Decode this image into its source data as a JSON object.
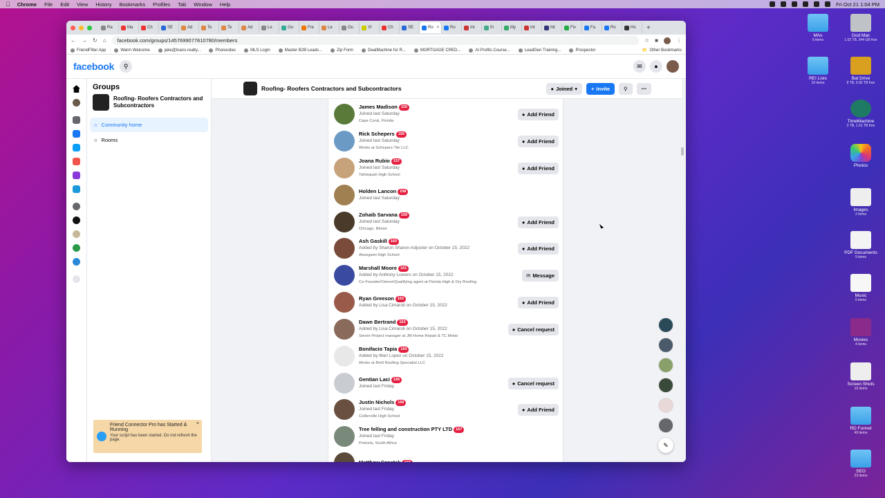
{
  "menubar": {
    "app": "Chrome",
    "items": [
      "File",
      "Edit",
      "View",
      "History",
      "Bookmarks",
      "Profiles",
      "Tab",
      "Window",
      "Help"
    ],
    "clock": "Fri Oct 21  1:04 PM"
  },
  "desktop": [
    {
      "label": "MAs",
      "sub": "6 items"
    },
    {
      "label": "God Mac",
      "sub": "1.02 TB, 344 GB free"
    },
    {
      "label": "REI Lists",
      "sub": "16 items"
    },
    {
      "label": "Bat Drive",
      "sub": "8 TB, 6.82 TB free"
    },
    {
      "label": "TimeMachine",
      "sub": "3 TB, 1.61 TB free"
    },
    {
      "label": "Photos",
      "sub": ""
    },
    {
      "label": "Images",
      "sub": "2 items"
    },
    {
      "label": "PDF Documents",
      "sub": "9 items"
    },
    {
      "label": "Music",
      "sub": "5 items"
    },
    {
      "label": "Movies",
      "sub": "4 items"
    },
    {
      "label": "Screen Shots",
      "sub": "16 items"
    },
    {
      "label": "RD Funnel",
      "sub": "49 items"
    },
    {
      "label": "SEO",
      "sub": "23 items"
    }
  ],
  "browser": {
    "tabs": [
      "Ra",
      "Ma",
      "Ch",
      "SE",
      "Ad",
      "Te",
      "Te",
      "Ad",
      "Le",
      "Go",
      "Fre",
      "Le",
      "Ou",
      "VI",
      "Ch",
      "SE",
      "Ro",
      "Ro",
      "Int",
      "fri",
      "My",
      "Int",
      "htt",
      "Fiv",
      "Fa",
      "Ro",
      "Ho"
    ],
    "url": "facebook.com/groups/1457699077810780/members",
    "bookmarks": [
      "FriendFilter App",
      "Warm Welcome",
      "jake@loans-realty...",
      "Phonesites",
      "MLS Login",
      "Master B2B Leads...",
      "Zip Form",
      "DealMachine for R...",
      "MORTGAGE CRED...",
      "AI Profits Course...",
      "LeadGen Training...",
      "Prospector"
    ],
    "other_bookmarks": "Other Bookmarks"
  },
  "fb": {
    "logo": "facebook",
    "sidebar": {
      "title": "Groups",
      "group_name": "Roofing- Roofers Contractors and Subcontractors",
      "nav": [
        {
          "label": "Community home"
        },
        {
          "label": "Rooms"
        }
      ]
    },
    "group_bar": {
      "title": "Roofing- Roofers Contractors and Subcontractors",
      "joined": "Joined",
      "invite": "Invite"
    },
    "toast": {
      "title": "Friend Connector Pro has Started & Running",
      "body": "Your script has been started. Do not refresh the page.",
      "close": "×"
    },
    "members": [
      {
        "name": "James Madison",
        "num": "155",
        "line1": "Joined last Saturday",
        "line2": "Cape Coral, Florida",
        "action": "Add Friend",
        "color": "#5a7a3a"
      },
      {
        "name": "Rick Schepers",
        "num": "156",
        "line1": "Joined last Saturday",
        "line2": "Works at Schepers Tile LLC",
        "action": "Add Friend",
        "color": "#6b9ac4"
      },
      {
        "name": "Joana Rubio",
        "num": "157",
        "line1": "Joined last Saturday",
        "line2": "Tahlequah High School",
        "action": "Add Friend",
        "color": "#c8a27a"
      },
      {
        "name": "Holden Lancon",
        "num": "158",
        "line1": "Joined last Saturday",
        "line2": "",
        "action": "",
        "color": "#a08050"
      },
      {
        "name": "Zohaib Sarvana",
        "num": "159",
        "line1": "Joined last Saturday",
        "line2": "Chicago, Illinois",
        "action": "Add Friend",
        "color": "#4a3a2a"
      },
      {
        "name": "Ash Gaskill",
        "num": "160",
        "line1": "Added by Sharon Sharon-Adjuster on October 15, 2022",
        "line2": "Absegami High School",
        "action": "Add Friend",
        "color": "#7a4a3a"
      },
      {
        "name": "Marshall Moore",
        "num": "161",
        "line1": "Added by Anthony Lowers on October 15, 2022",
        "line2": "Co-Founder/Owner/Qualifying agent at Florida High & Dry Roofing",
        "action": "Message",
        "color": "#3a4aa0"
      },
      {
        "name": "Ryan Greeson",
        "num": "162",
        "line1": "Added by Lisa Cimaroli on October 15, 2022",
        "line2": "",
        "action": "Add Friend",
        "color": "#9a5a4a"
      },
      {
        "name": "Dawn Bertrand",
        "num": "163",
        "line1": "Added by Lisa Cimaroli on October 15, 2022",
        "line2": "Senior Project manager at JM Home Repair & TC Metal",
        "action": "Cancel request",
        "color": "#8a6a5a"
      },
      {
        "name": "Bonifacio Tapia",
        "num": "164",
        "line1": "Added by Mari Lopez on October 15, 2022",
        "line2": "Works at Bmtl Roofing Specialist LLC",
        "action": "",
        "color": "#e8e8e8"
      },
      {
        "name": "Gentian Laci",
        "num": "165",
        "line1": "Joined last Friday",
        "line2": "",
        "action": "Cancel request",
        "color": "#c9ccd1"
      },
      {
        "name": "Justin Nichols",
        "num": "166",
        "line1": "Joined last Friday",
        "line2": "Collierville High School",
        "action": "Add Friend",
        "color": "#6a5040"
      },
      {
        "name": "Tree felling and construction PTY LTD",
        "num": "167",
        "line1": "Joined last Friday",
        "line2": "Pretoria, South Africa",
        "action": "",
        "color": "#7a8a7a"
      },
      {
        "name": "Matthew Szostek",
        "num": "168",
        "line1": "",
        "line2": "",
        "action": "",
        "color": "#5a4a3a"
      }
    ]
  }
}
